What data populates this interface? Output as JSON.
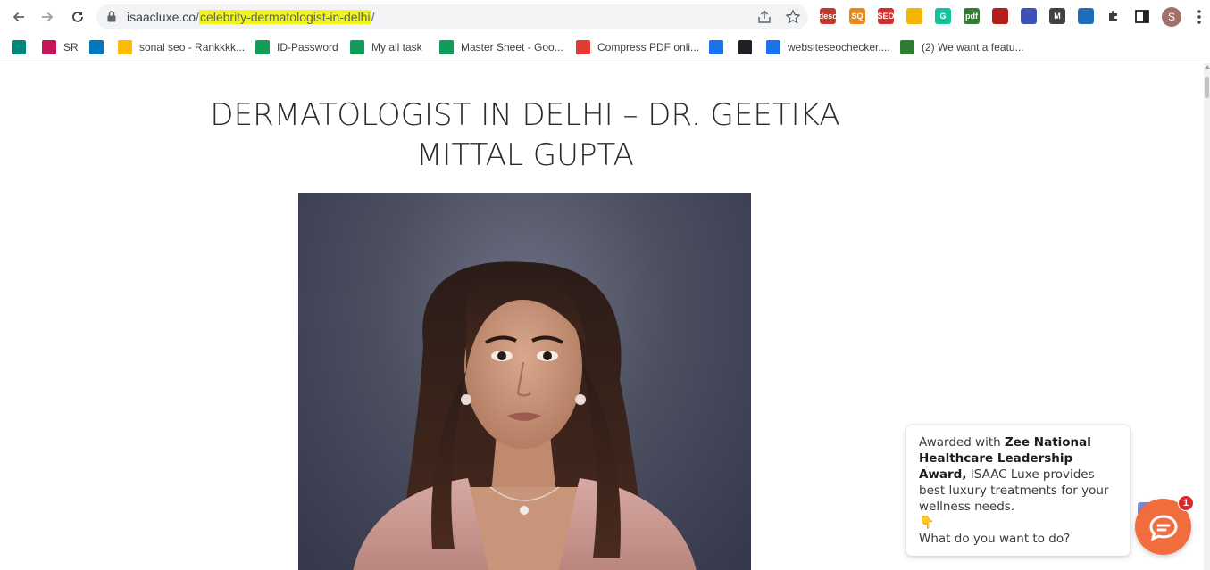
{
  "browser": {
    "url_domain": "isaacluxe.co",
    "url_sep": "/",
    "url_path_highlight": "celebrity-dermatologist-in-delhi",
    "url_trailing": "/",
    "extensions": [
      {
        "name": "desc-extension-icon",
        "label": "desc",
        "color": "#c0392b"
      },
      {
        "name": "seo-quake-icon",
        "label": "SQ",
        "color": "#e8891c"
      },
      {
        "name": "seo-extension-icon",
        "label": "SEO",
        "color": "#d32f2f"
      },
      {
        "name": "keep-icon",
        "label": "",
        "color": "#f4b400"
      },
      {
        "name": "grammarly-icon",
        "label": "G",
        "color": "#15c39a"
      },
      {
        "name": "pdf-extension-icon",
        "label": "pdf",
        "color": "#2e7d32"
      },
      {
        "name": "heart-extension-icon",
        "label": "",
        "color": "#b71c1c"
      },
      {
        "name": "color-picker-icon",
        "label": "",
        "color": "#3f51b5"
      },
      {
        "name": "mail-extension-icon",
        "label": "M",
        "color": "#424242"
      },
      {
        "name": "scraper-extension-icon",
        "label": "",
        "color": "#1e6fb8"
      }
    ],
    "avatar_letter": "S"
  },
  "bookmarks": [
    {
      "name": "bookmark-meet",
      "label": "",
      "icon_color": "#00897b"
    },
    {
      "name": "bookmark-sr",
      "label": "SR",
      "icon_color": "#c2185b"
    },
    {
      "name": "bookmark-trello",
      "label": "",
      "icon_color": "#0079bf"
    },
    {
      "name": "bookmark-sonal-seo",
      "label": "sonal seo - Rankkkk...",
      "icon_color": "#fbbc04"
    },
    {
      "name": "bookmark-id-password",
      "label": "ID-Password",
      "icon_color": "#0f9d58"
    },
    {
      "name": "bookmark-my-all-task",
      "label": "My all task",
      "icon_color": "#0f9d58"
    },
    {
      "name": "bookmark-master-sheet",
      "label": "Master Sheet - Goo...",
      "icon_color": "#0f9d58"
    },
    {
      "name": "bookmark-compress-pdf",
      "label": "Compress PDF onli...",
      "icon_color": "#e53935"
    },
    {
      "name": "bookmark-maps",
      "label": "",
      "icon_color": "#1a73e8"
    },
    {
      "name": "bookmark-analytics",
      "label": "",
      "icon_color": "#202124"
    },
    {
      "name": "bookmark-websiteseochecker",
      "label": "websiteseochecker....",
      "icon_color": "#1a73e8"
    },
    {
      "name": "bookmark-feature-request",
      "label": "(2) We want a featu...",
      "icon_color": "#2e7d32"
    }
  ],
  "page": {
    "title": "DERMATOLOGIST IN DELHI – DR. GEETIKA MITTAL GUPTA"
  },
  "chat": {
    "intro": "Awarded with ",
    "award": "Zee National Healthcare Leadership Award,",
    "rest": " ISAAC Luxe provides best luxury treatments for your wellness needs.",
    "hand": "👇",
    "question": "What do you want to do?",
    "badge_count": "1",
    "brand_color": "#f26d3d"
  }
}
